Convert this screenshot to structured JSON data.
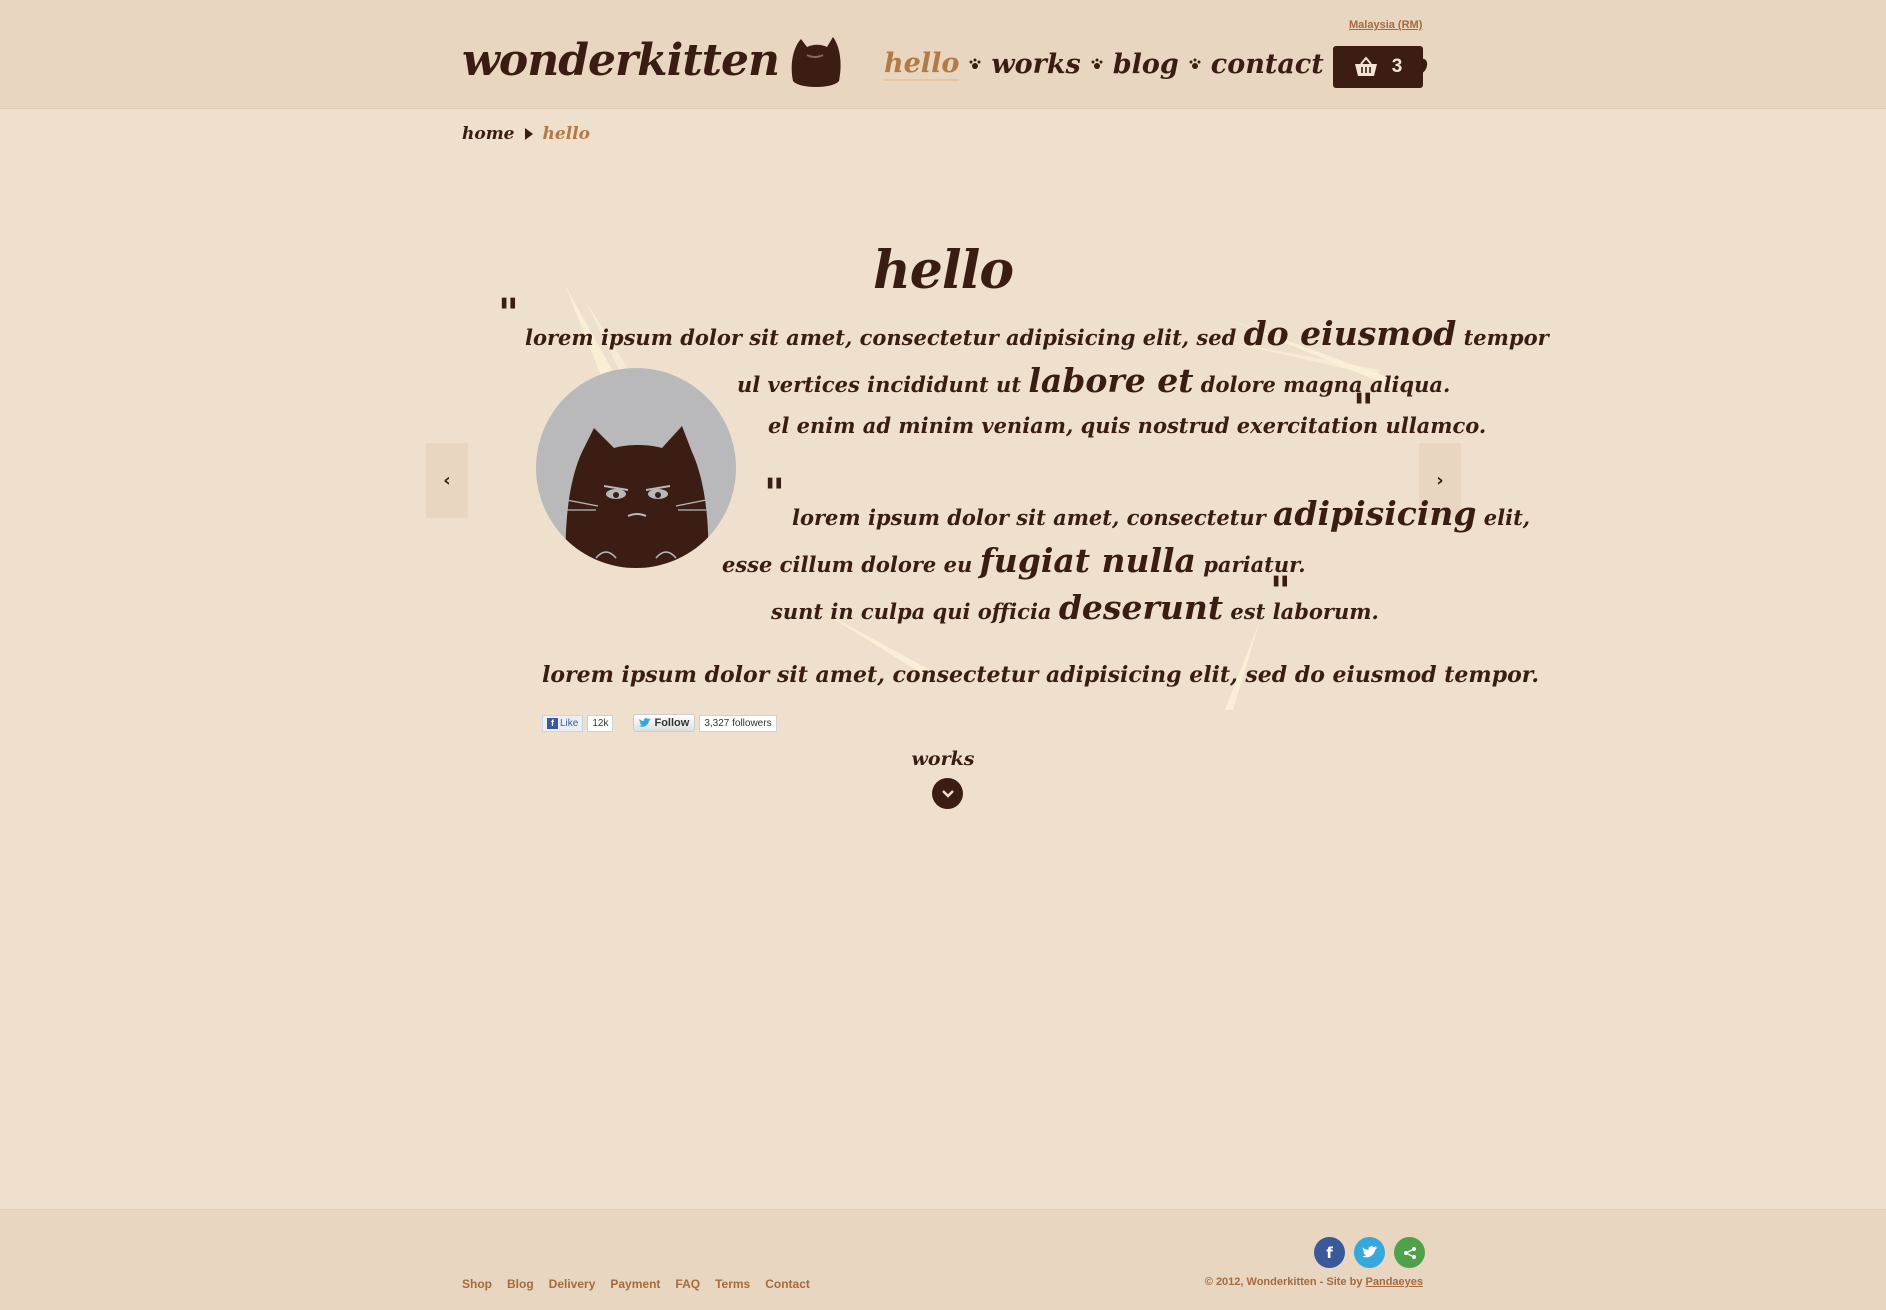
{
  "header": {
    "region": "Malaysia (RM)",
    "logo": "wonderkitten",
    "nav": [
      "hello",
      "works",
      "blog",
      "contact",
      "shop"
    ],
    "cart_count": "3"
  },
  "breadcrumb": {
    "home": "home",
    "current": "hello"
  },
  "main": {
    "title": "hello",
    "quote1": {
      "l1a": "lorem ipsum dolor sit amet, consectetur adipisicing elit, sed",
      "l1b": "do eiusmod",
      "l1c": "tempor",
      "l2a": "ul vertices incididunt ut",
      "l2b": "labore et",
      "l2c": "dolore magna aliqua.",
      "l3": "el enim ad minim veniam, quis nostrud exercitation ullamco."
    },
    "quote2": {
      "l1a": "lorem ipsum dolor sit amet, consectetur",
      "l1b": "adipisicing",
      "l1c": "elit,",
      "l2a": "esse cillum dolore eu",
      "l2b": "fugiat nulla",
      "l2c": "pariatur.",
      "l3a": "sunt in culpa qui officia",
      "l3b": "deserunt",
      "l3c": "est laborum."
    },
    "lead": "lorem ipsum dolor sit amet, consectetur adipisicing elit, sed do eiusmod tempor.",
    "social": {
      "fb_like": "Like",
      "fb_count": "12k",
      "tw_follow": "Follow",
      "tw_count": "3,327 followers"
    },
    "works_label": "works"
  },
  "footer": {
    "links": [
      "Shop",
      "Blog",
      "Delivery",
      "Payment",
      "FAQ",
      "Terms",
      "Contact"
    ],
    "copyright": "© 2012, Wonderkitten - Site by",
    "credit": "Pandaeyes"
  },
  "colors": {
    "brown": "#3a1d12",
    "accent": "#b27a44",
    "bg": "#efe0cd",
    "header_bg": "#e8d6c0"
  }
}
